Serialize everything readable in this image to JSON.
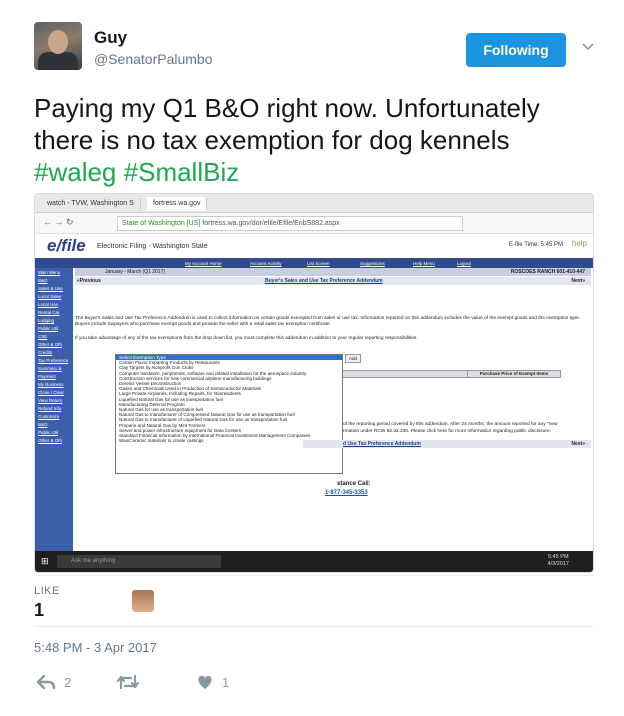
{
  "user": {
    "name": "Guy",
    "handle": "@SenatorPalumbo",
    "follow_label": "Following"
  },
  "tweet": {
    "text": "Paying my Q1 B&O right now. Unfortunately there is no tax exemption for dog kennels ",
    "hashtag1": "#waleg",
    "hashtag2": "#SmallBiz"
  },
  "screenshot": {
    "tabs": [
      "watch - TVW, Washington S",
      "fortress.wa.gov"
    ],
    "address_secure": "State of Washington [US]",
    "address_url": "fortress.wa.gov/dor/efile/Efile/EnbS882.aspx",
    "efile_logo": "e/file",
    "efile_sub": "Electronic Filing - Washington State",
    "efile_time": "E-file Time: 5:45 PM",
    "help": "help",
    "nav": [
      "My Account Home",
      "Account Activity",
      "List Screen",
      "Suggestions",
      "Help Menu",
      "Logout"
    ],
    "sidebar": [
      "Main Menu",
      "B&O",
      "Sales & Use",
      "Local Sales",
      "Local Use",
      "Rental Car",
      "Lodging",
      "Public Util",
      "CSE",
      "Other & Oth",
      "Credits",
      "Tax Preference",
      "Summary &",
      "Payment",
      "My Business",
      "Close / Clear",
      "View Return",
      "Refund Info",
      "Customize",
      "B&O",
      "Public Util",
      "Other & Oth"
    ],
    "period": "January - March (Q1 2017)",
    "business": "ROSCOES RANCH 601-410-447",
    "previous": "«Previous",
    "next": "Next»",
    "addendum_title": "Buyer's Sales and Use Tax Preference Addendum",
    "para1": "The Buyer's Sales and Use Tax Preference Addendum is used to collect information on certain goods exempted from sales or use tax. Information reported on this addendum includes the value of the exempt goods and the exemption type. Buyers include taxpayers who purchase exempt goods and provide the seller with a retail sales tax exemption certificate.",
    "para2": "If you take advantage of any of the tax exemptions from the drop down list, you must complete this addendum in addition to your regular reporting responsibilities.",
    "add_label": "Add",
    "price_col": "Purchase Price of Exempt Items",
    "dropdown_options": [
      "Select Exemption Type",
      "Certain Flavor Imparting Products by Restaurants",
      "Clay Targets by Nonprofit Gun Clubs",
      "Computer hardware, peripherals, software and related installation for the aerospace industry",
      "Construction services for new commercial airplane manufacturing buildings",
      "Derelict Vessel Deconstruction",
      "Gases and Chemicals Used in Production of Semiconductor Materials",
      "Large Private Airplanes, Including Repairs, for Nonresidents",
      "Liquefied Natural Gas for use as transportation fuel",
      "Manufacturing Deferral Program",
      "Natural Gas for use as transportation fuel",
      "Natural Gas to manufacturer of Compressed Natural Gas for use as transportation fuel",
      "Natural Gas to manufacturer of Liquefied Natural Gas for use as transportation fuel",
      "Propane and Natural Gas by Mint Farmers",
      "Server and power infrastructure equipment for Data Centers",
      "Standard Financial Information by International Financial Investment Management Companies",
      "Wax/Ceramic materials to create castings"
    ],
    "para3a": "of the reporting period covered by this addendum. After 24 months, the amount reported for any \"new",
    "para3b": "rmation under RCW 82.32.330. Please click here for more information regarding public disclosure.",
    "addendum_footer": "d Use Tax Preference Addendum",
    "assist": "stance Call:",
    "phone": "1-877-345-3353",
    "taskbar_search": "Ask me anything",
    "taskbar_time": "5:45 PM",
    "taskbar_date": "4/3/2017"
  },
  "stats": {
    "likes_label": "LIKE",
    "likes_count": "1"
  },
  "timestamp": "5:48 PM - 3 Apr 2017",
  "actions": {
    "reply_count": "2",
    "retweet_count": "",
    "like_count": "1"
  },
  "colors": {
    "follow": "#1b95e0",
    "hashtag": "#1da94f",
    "meta": "#657786"
  }
}
